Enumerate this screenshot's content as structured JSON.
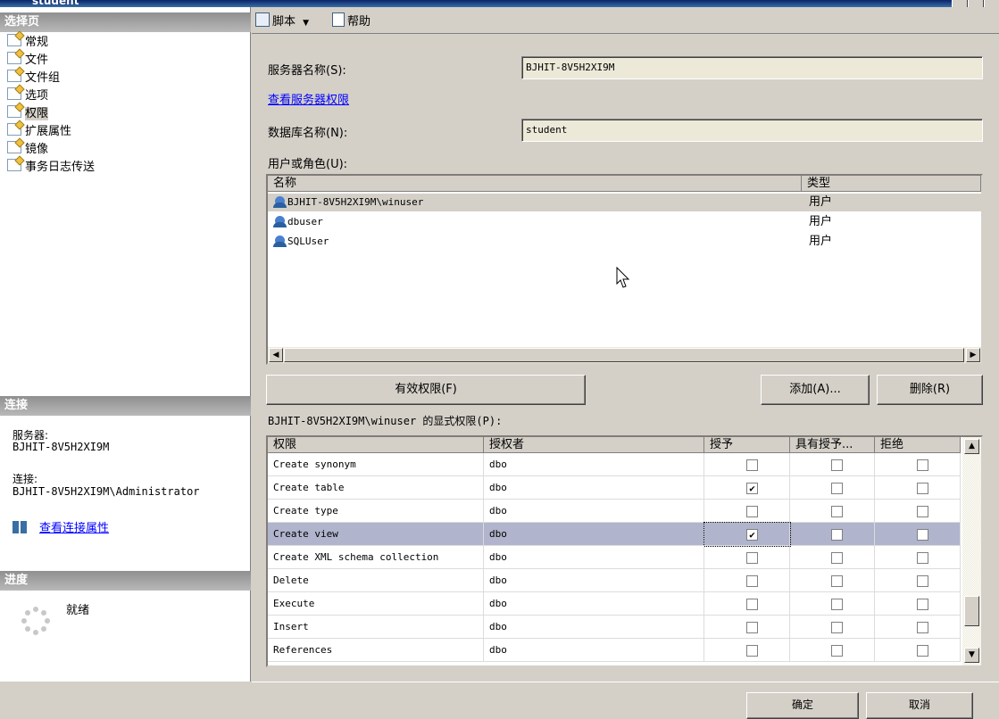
{
  "window": {
    "title": "student"
  },
  "left_pane": {
    "select_page_header": "选择页",
    "nav_items": [
      {
        "label": "常规",
        "selected": false
      },
      {
        "label": "文件",
        "selected": false
      },
      {
        "label": "文件组",
        "selected": false
      },
      {
        "label": "选项",
        "selected": false
      },
      {
        "label": "权限",
        "selected": true
      },
      {
        "label": "扩展属性",
        "selected": false
      },
      {
        "label": "镜像",
        "selected": false
      },
      {
        "label": "事务日志传送",
        "selected": false
      }
    ],
    "connection_header": "连接",
    "server_label": "服务器:",
    "server_value": "BJHIT-8V5H2XI9M",
    "connection_label": "连接:",
    "connection_value": "BJHIT-8V5H2XI9M\\Administrator",
    "view_connection_link": "查看连接属性",
    "progress_header": "进度",
    "progress_status": "就绪"
  },
  "toolbar": {
    "script_label": "脚本",
    "help_label": "帮助"
  },
  "form": {
    "server_name_label": "服务器名称(S):",
    "server_name_value": "BJHIT-8V5H2XI9M",
    "view_server_permissions_link": "查看服务器权限",
    "database_name_label": "数据库名称(N):",
    "database_name_value": "student",
    "users_roles_label": "用户或角色(U):"
  },
  "users_grid": {
    "headers": [
      "名称",
      "类型"
    ],
    "rows": [
      {
        "name": "BJHIT-8V5H2XI9M\\winuser",
        "type": "用户",
        "selected": true
      },
      {
        "name": "dbuser",
        "type": "用户",
        "selected": false
      },
      {
        "name": "SQLUser",
        "type": "用户",
        "selected": false
      }
    ]
  },
  "buttons": {
    "effective_permissions": "有效权限(F)",
    "add": "添加(A)...",
    "remove": "删除(R)",
    "ok": "确定",
    "cancel": "取消"
  },
  "permissions": {
    "label": "BJHIT-8V5H2XI9M\\winuser 的显式权限(P):",
    "headers": [
      "权限",
      "授权者",
      "授予",
      "具有授予...",
      "拒绝"
    ],
    "rows": [
      {
        "permission": "Create synonym",
        "grantor": "dbo",
        "grant": false,
        "with_grant": false,
        "deny": false,
        "selected": false
      },
      {
        "permission": "Create table",
        "grantor": "dbo",
        "grant": true,
        "with_grant": false,
        "deny": false,
        "selected": false
      },
      {
        "permission": "Create type",
        "grantor": "dbo",
        "grant": false,
        "with_grant": false,
        "deny": false,
        "selected": false
      },
      {
        "permission": "Create view",
        "grantor": "dbo",
        "grant": true,
        "with_grant": false,
        "deny": false,
        "selected": true
      },
      {
        "permission": "Create XML schema collection",
        "grantor": "dbo",
        "grant": false,
        "with_grant": false,
        "deny": false,
        "selected": false
      },
      {
        "permission": "Delete",
        "grantor": "dbo",
        "grant": false,
        "with_grant": false,
        "deny": false,
        "selected": false
      },
      {
        "permission": "Execute",
        "grantor": "dbo",
        "grant": false,
        "with_grant": false,
        "deny": false,
        "selected": false
      },
      {
        "permission": "Insert",
        "grantor": "dbo",
        "grant": false,
        "with_grant": false,
        "deny": false,
        "selected": false
      },
      {
        "permission": "References",
        "grantor": "dbo",
        "grant": false,
        "with_grant": false,
        "deny": false,
        "selected": false
      }
    ]
  },
  "colors": {
    "selection": "#b0b4cc",
    "link": "#0000ff",
    "section_header": "#a0a0a0"
  }
}
